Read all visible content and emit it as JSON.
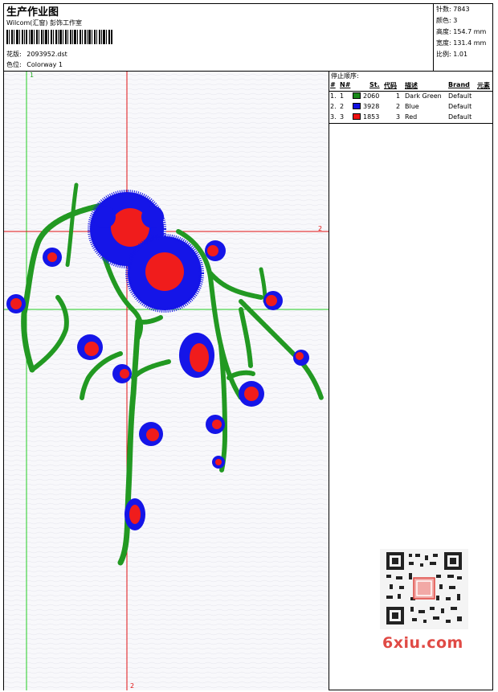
{
  "header": {
    "title": "生产作业图",
    "company": "Wilcom(汇窗) 彭饰工作室",
    "design_label": "花版:",
    "design_file": "2093952.dst",
    "colorway_label": "色位:",
    "colorway": "Colorway 1"
  },
  "stats": [
    {
      "label": "针数:",
      "value": "7843"
    },
    {
      "label": "颜色:",
      "value": "3"
    },
    {
      "label": "高度:",
      "value": "154.7 mm"
    },
    {
      "label": "宽度:",
      "value": "131.4 mm"
    },
    {
      "label": "比例:",
      "value": "1.01"
    }
  ],
  "guides": {
    "v1": "1",
    "h2": "2",
    "v2": "2"
  },
  "stop_sequence": {
    "title": "停止顺序:",
    "columns": [
      "#",
      "N#",
      "St.",
      "代码",
      "描述",
      "Brand",
      "元素"
    ],
    "rows": [
      {
        "idx": "1.",
        "n": "1",
        "st": "2060",
        "code": "1",
        "desc": "Dark Green",
        "brand": "Default",
        "color": "#1a8a1a"
      },
      {
        "idx": "2.",
        "n": "2",
        "st": "3928",
        "code": "2",
        "desc": "Blue",
        "brand": "Default",
        "color": "#1010e0"
      },
      {
        "idx": "3.",
        "n": "3",
        "st": "1853",
        "code": "3",
        "desc": "Red",
        "brand": "Default",
        "color": "#ee1111"
      }
    ]
  },
  "watermark": {
    "site": "6xiu.com"
  },
  "colors": {
    "green": "#229922",
    "blue": "#1515e8",
    "red": "#f01c1c",
    "guide_red": "#e01010",
    "guide_green": "#22cc22"
  }
}
